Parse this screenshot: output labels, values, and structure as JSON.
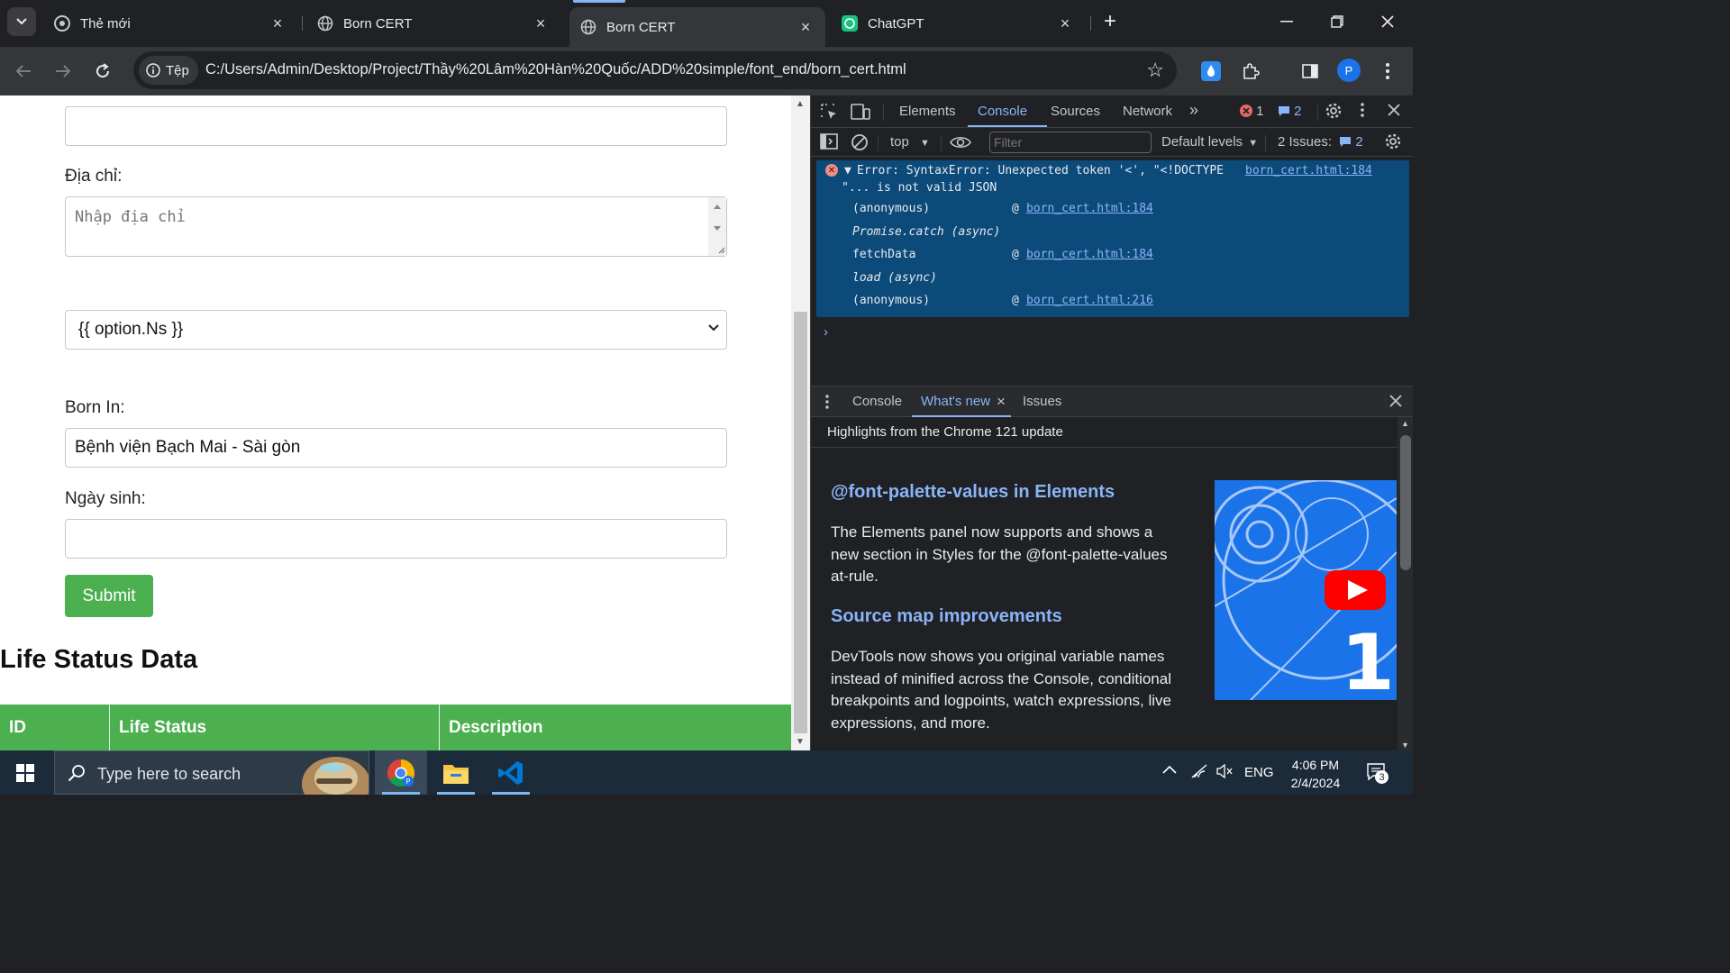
{
  "tabs": [
    {
      "title": "Thẻ mới"
    },
    {
      "title": "Born CERT"
    },
    {
      "title": "Born CERT"
    },
    {
      "title": "ChatGPT"
    }
  ],
  "omnibox": {
    "chip_label": "Tệp",
    "url": "C:/Users/Admin/Desktop/Project/Thầy%20Lâm%20Hàn%20Quốc/ADD%20simple/font_end/born_cert.html"
  },
  "profile_initial": "P",
  "form": {
    "address_label": "Địa chỉ:",
    "address_placeholder": "Nhập địa chỉ",
    "select_value": "{{ option.Ns }}",
    "born_in_label": "Born In:",
    "born_in_value": "Bệnh viện Bạch Mai - Sài gòn",
    "dob_label": "Ngày sinh:",
    "submit_label": "Submit"
  },
  "life_status": {
    "heading": "Life Status Data",
    "columns": [
      "ID",
      "Life Status",
      "Description"
    ]
  },
  "devtools": {
    "tabs": [
      "Elements",
      "Console",
      "Sources",
      "Network"
    ],
    "error_count": "1",
    "message_count": "2",
    "context": "top",
    "filter_placeholder": "Filter",
    "levels": "Default levels",
    "issues_label": "2 Issues:",
    "issues_count": "2",
    "error": {
      "line1": "Error: SyntaxError: Unexpected token '<', \"<!DOCTYPE",
      "line2": "\"... is not valid JSON",
      "source": "born_cert.html:184",
      "stack": [
        {
          "fn": "(anonymous)",
          "at": "@",
          "src": "born_cert.html:184"
        },
        {
          "fn": "Promise.catch (async)",
          "at": "",
          "src": ""
        },
        {
          "fn": "fetchData",
          "at": "@",
          "src": "born_cert.html:184"
        },
        {
          "fn": "load (async)",
          "at": "",
          "src": ""
        },
        {
          "fn": "(anonymous)",
          "at": "@",
          "src": "born_cert.html:216"
        }
      ]
    },
    "drawer": {
      "tabs": [
        "Console",
        "What's new",
        "Issues"
      ],
      "header": "Highlights from the Chrome 121 update",
      "h1": "@font-palette-values in Elements",
      "p1": "The Elements panel now supports and shows a new section in Styles for the @font-palette-values at-rule.",
      "h2": "Source map improvements",
      "p2": "DevTools now shows you original variable names instead of minified across the Console, conditional breakpoints and logpoints, watch expressions, live expressions, and more."
    }
  },
  "taskbar": {
    "search_placeholder": "Type here to search",
    "lang": "ENG",
    "time": "4:06 PM",
    "date": "2/4/2024",
    "notif_count": "3"
  },
  "colors": {
    "submit": "#4caf50",
    "link": "#8ab4f8",
    "error_bg": "#0c4a7a",
    "taskbar": "#1c2b3a"
  }
}
